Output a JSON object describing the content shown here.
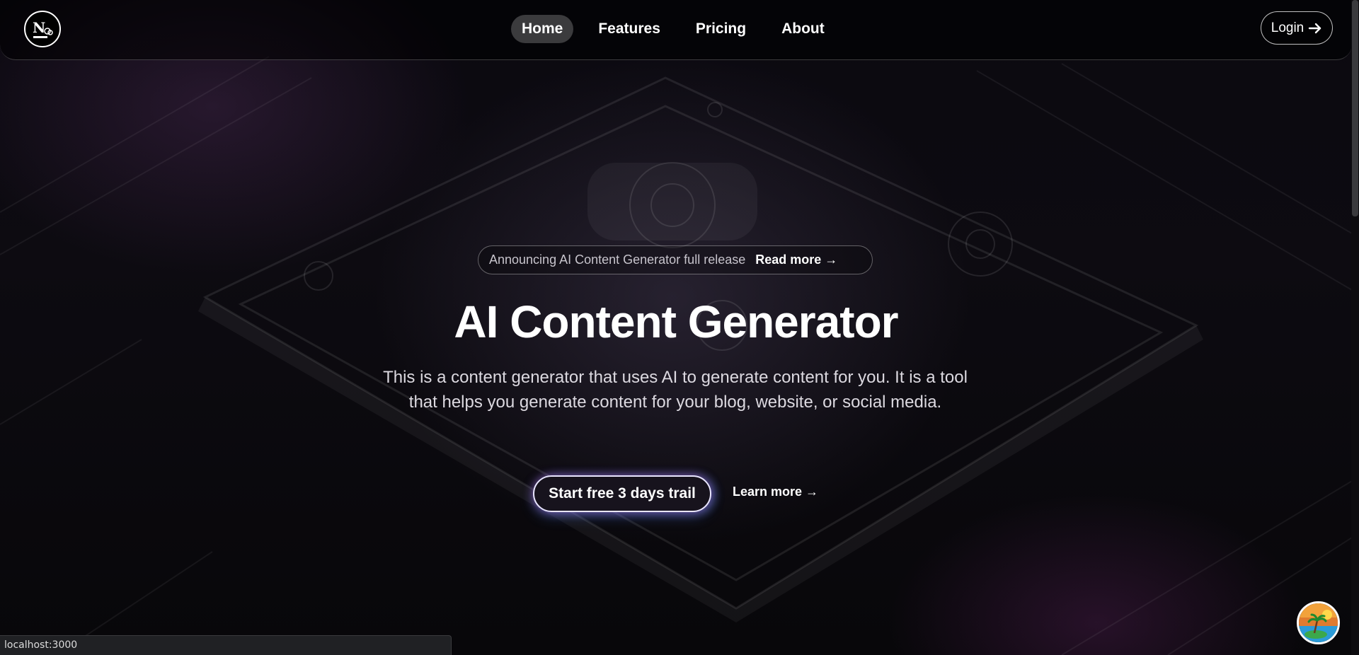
{
  "header": {
    "nav": [
      {
        "label": "Home",
        "active": true
      },
      {
        "label": "Features",
        "active": false
      },
      {
        "label": "Pricing",
        "active": false
      },
      {
        "label": "About",
        "active": false
      }
    ],
    "login_label": "Login"
  },
  "hero": {
    "announcement": "Announcing AI Content Generator full release",
    "announcement_link": "Read more →",
    "title": "AI Content Generator",
    "description": "This is a content generator that uses AI to generate content for you. It is a tool that helps you generate content for your blog, website, or social media.",
    "primary_cta": "Start free 3 days trail",
    "secondary_cta": "Learn more →"
  },
  "statusbar": {
    "url": "localhost:3000"
  },
  "colors": {
    "background": "#050407",
    "accent_glow": "#b45ac8",
    "accent_blue": "#5096ff"
  },
  "icons": {
    "logo": "logo-icon",
    "login_arrow": "arrow-right-icon",
    "floating": "beach-avatar-icon"
  }
}
